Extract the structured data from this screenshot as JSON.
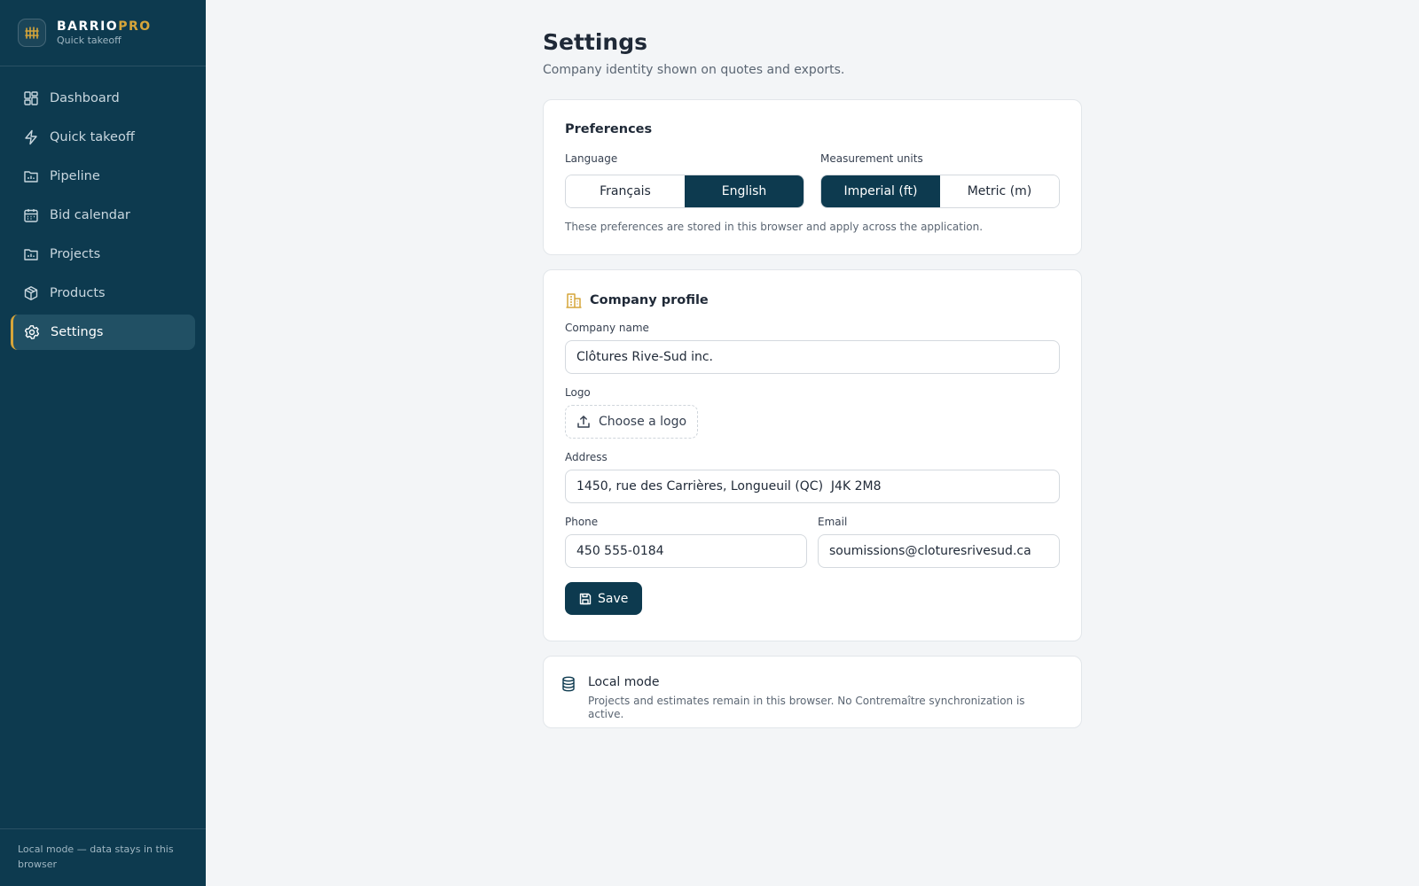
{
  "brand": {
    "name_main": "BARRIO",
    "name_accent": "PRO",
    "subtitle": "Quick takeoff"
  },
  "sidebar": {
    "items": [
      {
        "label": "Dashboard",
        "icon": "dashboard-grid-icon"
      },
      {
        "label": "Quick takeoff",
        "icon": "lightning-icon"
      },
      {
        "label": "Pipeline",
        "icon": "folder-chart-icon"
      },
      {
        "label": "Bid calendar",
        "icon": "calendar-icon"
      },
      {
        "label": "Projects",
        "icon": "folder-chart-icon"
      },
      {
        "label": "Products",
        "icon": "box-icon"
      },
      {
        "label": "Settings",
        "icon": "gear-icon",
        "active": true
      }
    ],
    "footer": "Local mode — data stays in this browser"
  },
  "page": {
    "title": "Settings",
    "subtitle": "Company identity shown on quotes and exports."
  },
  "preferences": {
    "title": "Preferences",
    "language": {
      "label": "Language",
      "options": [
        "Français",
        "English"
      ],
      "selected": "English"
    },
    "units": {
      "label": "Measurement units",
      "options": [
        "Imperial (ft)",
        "Metric (m)"
      ],
      "selected": "Imperial (ft)"
    },
    "note": "These preferences are stored in this browser and apply across the application."
  },
  "company": {
    "title": "Company profile",
    "name_label": "Company name",
    "name_value": "Clôtures Rive-Sud inc.",
    "logo_label": "Logo",
    "logo_button": "Choose a logo",
    "address_label": "Address",
    "address_value": "1450, rue des Carrières, Longueuil (QC)  J4K 2M8",
    "phone_label": "Phone",
    "phone_value": "450 555-0184",
    "email_label": "Email",
    "email_value": "soumissions@cloturesrivesud.ca",
    "save_label": "Save"
  },
  "local_mode": {
    "title": "Local mode",
    "description": "Projects and estimates remain in this browser. No Contremaître synchronization is active."
  },
  "colors": {
    "sidebar_bg": "#0d3a4f",
    "accent": "#d6a53a",
    "primary_button": "#0d3a4f",
    "page_bg": "#f3f5f7"
  }
}
